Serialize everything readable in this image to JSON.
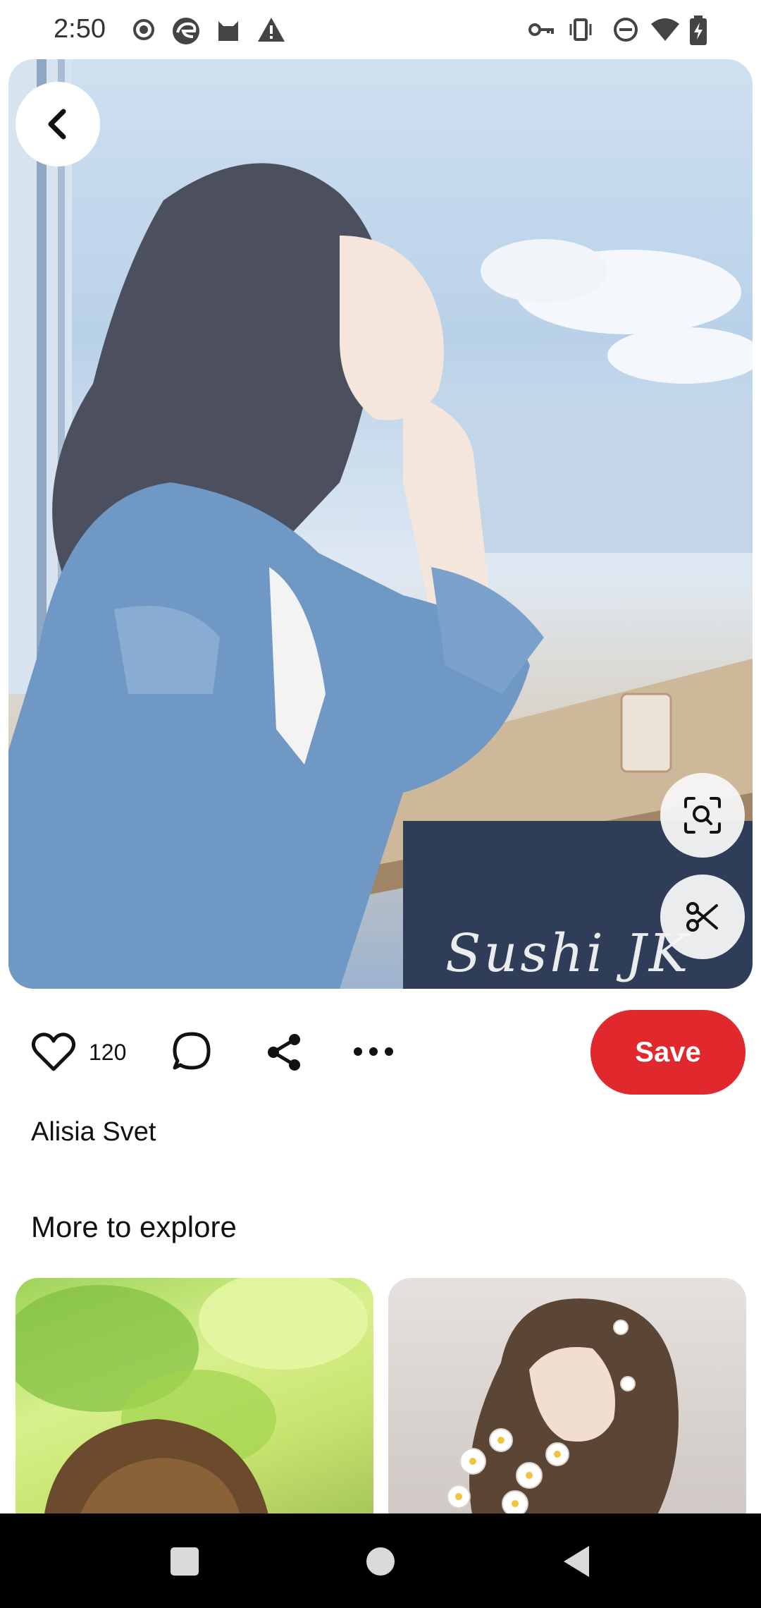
{
  "status_bar": {
    "time": "2:50",
    "left_icons": [
      "record-icon",
      "edge-icon",
      "cat-icon",
      "warning-icon"
    ],
    "right_icons": [
      "vpn-key-icon",
      "vibrate-icon",
      "dnd-icon",
      "wifi-icon",
      "battery-icon"
    ]
  },
  "pin": {
    "watermark": "Sushi JK",
    "like_count": "120",
    "save_label": "Save",
    "author": "Alisia Svet"
  },
  "explore": {
    "title": "More to explore"
  },
  "colors": {
    "save": "#e0282d",
    "background": "#ffffff",
    "nav_bar": "#000000"
  },
  "icons": {
    "back": "chevron-left-icon",
    "visual_search": "visual-search-icon",
    "cutout": "scissors-icon",
    "like": "heart-icon",
    "comment": "comment-icon",
    "share": "share-icon",
    "more": "more-icon"
  }
}
